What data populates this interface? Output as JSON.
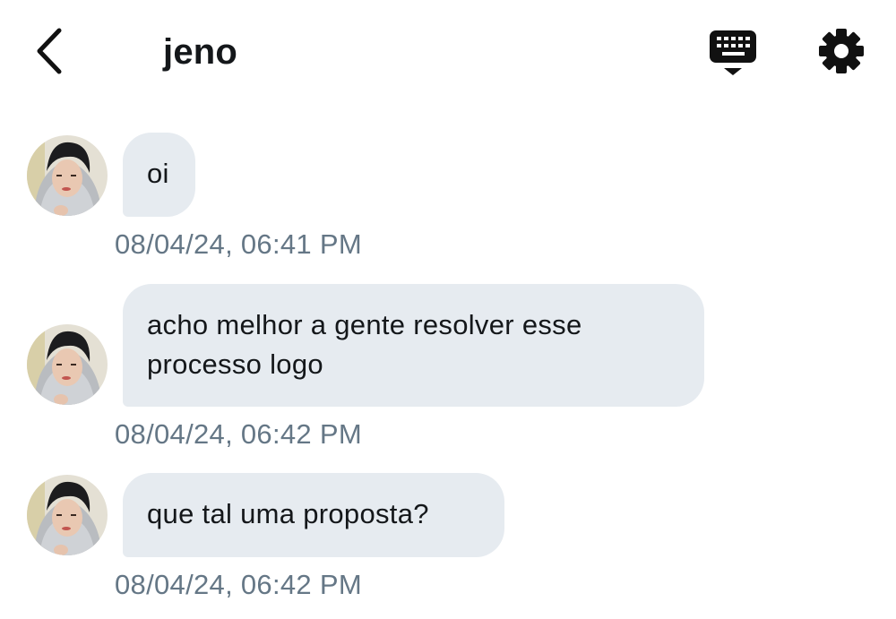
{
  "header": {
    "title": "jeno",
    "back_icon": "chevron-left-icon",
    "keyboard_icon": "keyboard-icon",
    "settings_icon": "gear-icon"
  },
  "messages": [
    {
      "text": "oi",
      "timestamp": "08/04/24, 06:41 PM"
    },
    {
      "text": "acho melhor a gente resolver esse processo logo",
      "timestamp": "08/04/24, 06:42 PM"
    },
    {
      "text": "que tal uma proposta?",
      "timestamp": "08/04/24, 06:42 PM"
    }
  ],
  "colors": {
    "bubble_background": "#e6ebf0",
    "timestamp_text": "#657786",
    "primary_text": "#14171a"
  }
}
